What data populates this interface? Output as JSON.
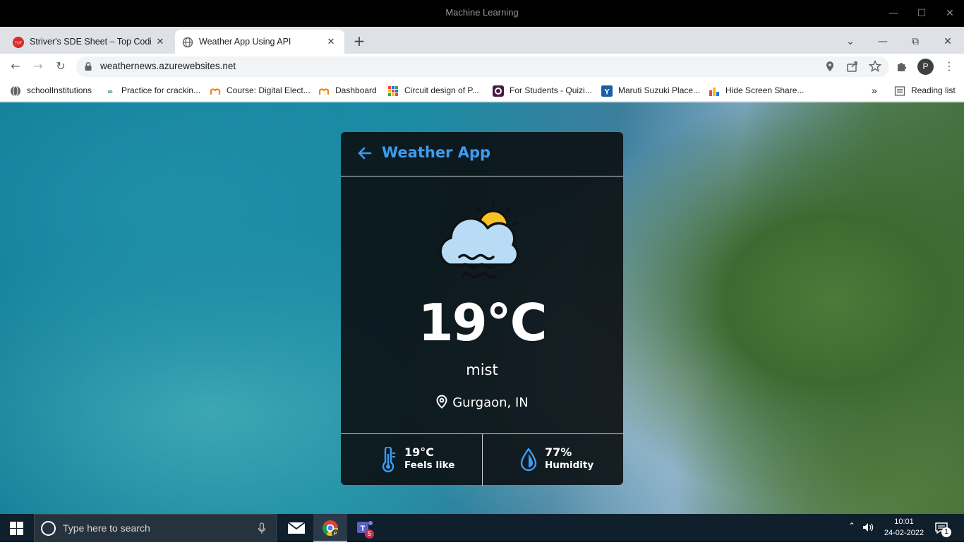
{
  "window": {
    "title": "Machine Learning"
  },
  "tabs": [
    {
      "label": "Striver's SDE Sheet – Top Coding",
      "favicon": "tuf-logo-icon",
      "active": false
    },
    {
      "label": "Weather App Using API",
      "favicon": "globe-icon",
      "active": true
    }
  ],
  "toolbar": {
    "url": "weathernews.azurewebsites.net",
    "profile_initial": "P"
  },
  "bookmarks": [
    {
      "label": "schoolInstitutions",
      "icon": "globe-icon"
    },
    {
      "label": "Practice for crackin...",
      "icon": "gfg-icon"
    },
    {
      "label": "Course: Digital Elect...",
      "icon": "moodle-icon"
    },
    {
      "label": "Dashboard",
      "icon": "moodle-icon"
    },
    {
      "label": "Circuit design  of P...",
      "icon": "tinkercad-icon"
    },
    {
      "label": "For Students - Quizi...",
      "icon": "quizizz-icon"
    },
    {
      "label": "Maruti Suzuki Place...",
      "icon": "yammer-icon"
    },
    {
      "label": "Hide Screen Share...",
      "icon": "chart-icon"
    }
  ],
  "bookmarks_overflow": "»",
  "reading_list": "Reading list",
  "weather": {
    "app_title": "Weather App",
    "temperature": "19°C",
    "description": "mist",
    "location": "Gurgaon, IN",
    "feels_like_value": "19°C",
    "feels_like_label": "Feels like",
    "humidity_value": "77%",
    "humidity_label": "Humidity",
    "accent_color": "#3f9bf0"
  },
  "taskbar": {
    "search_placeholder": "Type here to search",
    "time": "10:01",
    "date": "24-02-2022",
    "notification_count": "1",
    "teams_badge": "5"
  }
}
